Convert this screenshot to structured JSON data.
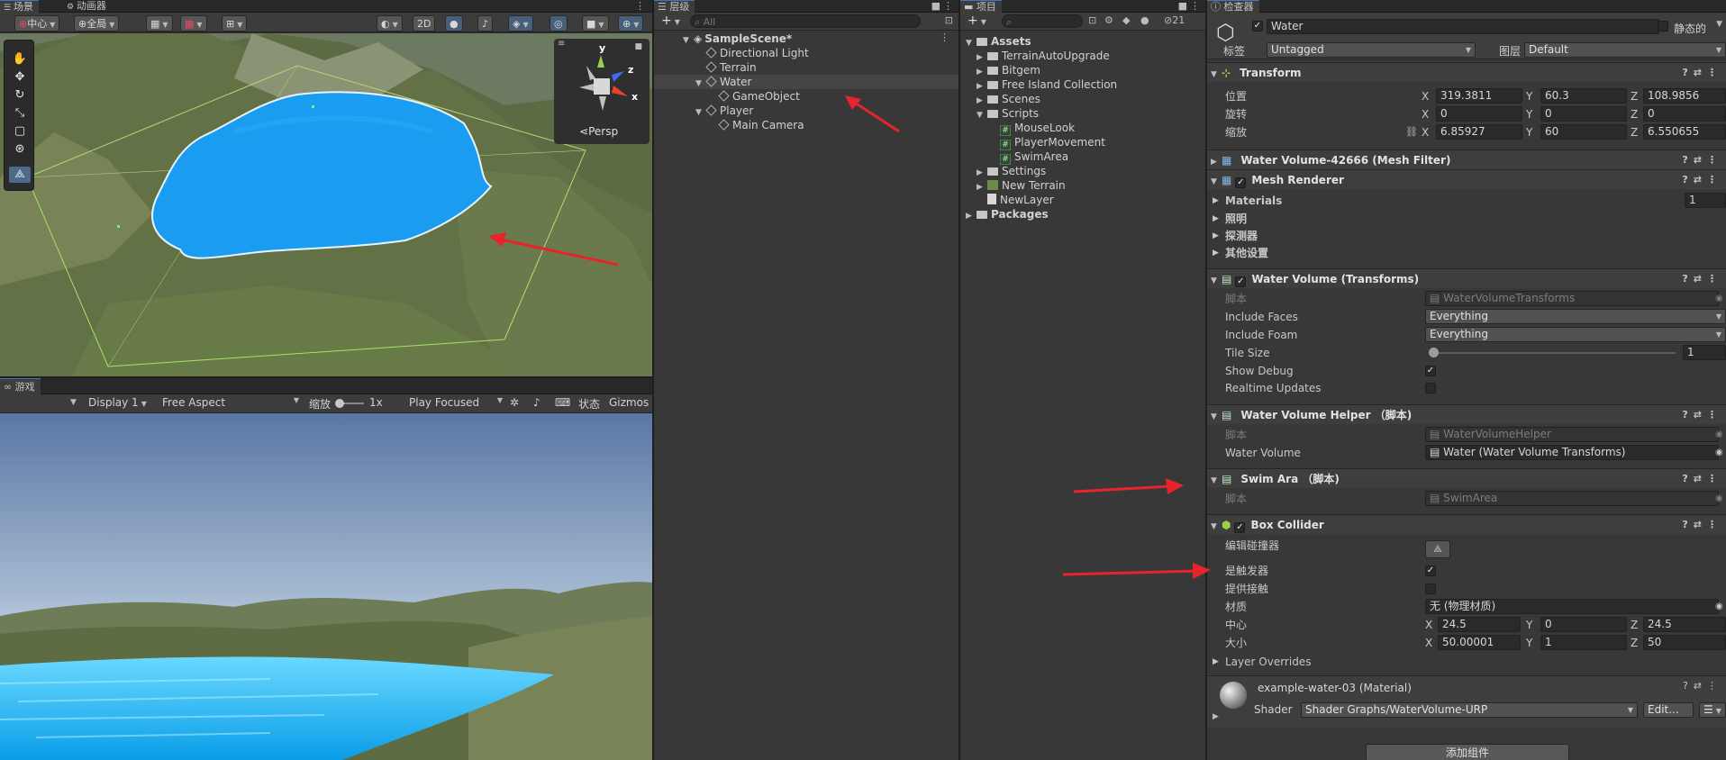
{
  "scene": {
    "tabs": [
      "场景",
      "动画器"
    ],
    "toolbar": {
      "pivot": "中心",
      "global": "全局",
      "mode2d": "2D"
    },
    "gizmo": {
      "y": "y",
      "z": "z",
      "x": "x",
      "persp": "Persp"
    }
  },
  "game": {
    "tab": "游戏",
    "toolbar": {
      "display": "Display 1",
      "aspect": "Free Aspect",
      "scale_label": "缩放",
      "scale_value": "1x",
      "play_mode": "Play Focused",
      "stats": "状态",
      "gizmos": "Gizmos"
    }
  },
  "hierarchy": {
    "tab": "层级",
    "search_placeholder": "All",
    "items": [
      {
        "label": "SampleScene*"
      },
      {
        "label": "Directional Light"
      },
      {
        "label": "Terrain"
      },
      {
        "label": "Water"
      },
      {
        "label": "GameObject"
      },
      {
        "label": "Player"
      },
      {
        "label": "Main Camera"
      }
    ]
  },
  "project": {
    "tab": "项目",
    "hidden_count": "21",
    "items": [
      {
        "label": "Assets"
      },
      {
        "label": "TerrainAutoUpgrade"
      },
      {
        "label": "Bitgem"
      },
      {
        "label": "Free Island Collection"
      },
      {
        "label": "Scenes"
      },
      {
        "label": "Scripts"
      },
      {
        "label": "MouseLook"
      },
      {
        "label": "PlayerMovement"
      },
      {
        "label": "SwimArea"
      },
      {
        "label": "Settings"
      },
      {
        "label": "New Terrain"
      },
      {
        "label": "NewLayer"
      },
      {
        "label": "Packages"
      }
    ]
  },
  "inspector": {
    "tab": "检查器",
    "object_name": "Water",
    "static_label": "静态的",
    "tag_label": "标签",
    "tag_value": "Untagged",
    "layer_label": "图层",
    "layer_value": "Default",
    "transform": {
      "title": "Transform",
      "position_label": "位置",
      "rotation_label": "旋转",
      "scale_label": "缩放",
      "position": {
        "x": "319.3811",
        "y": "60.3",
        "z": "108.9856"
      },
      "rotation": {
        "x": "0",
        "y": "0",
        "z": "0"
      },
      "scale": {
        "x": "6.85927",
        "y": "60",
        "z": "6.550655"
      }
    },
    "mesh_filter": {
      "title": "Water Volume-42666 (Mesh Filter)"
    },
    "mesh_renderer": {
      "title": "Mesh Renderer",
      "materials_label": "Materials",
      "materials_count": "1",
      "lighting": "照明",
      "probes": "探测器",
      "other": "其他设置"
    },
    "water_volume": {
      "title": "Water  Volume (Transforms)",
      "script_label": "脚本",
      "script_value": "WaterVolumeTransforms",
      "include_faces_label": "Include Faces",
      "include_faces_value": "Everything",
      "include_foam_label": "Include Foam",
      "include_foam_value": "Everything",
      "tile_size_label": "Tile Size",
      "tile_size_value": "1",
      "show_debug_label": "Show Debug",
      "realtime_label": "Realtime Updates"
    },
    "helper": {
      "title": "Water Volume Helper （脚本)",
      "script_label": "脚本",
      "script_value": "WaterVolumeHelper",
      "water_volume_label": "Water Volume",
      "water_volume_value": "Water (Water Volume Transforms)"
    },
    "swim": {
      "title": "Swim Ara （脚本)",
      "script_label": "脚本",
      "script_value": "SwimArea"
    },
    "box_collider": {
      "title": "Box Collider",
      "edit_label": "编辑碰撞器",
      "trigger_label": "是触发器",
      "contacts_label": "提供接触",
      "material_label": "材质",
      "material_value": "无 (物理材质)",
      "center_label": "中心",
      "center": {
        "x": "24.5",
        "y": "0",
        "z": "24.5"
      },
      "size_label": "大小",
      "size": {
        "x": "50.00001",
        "y": "1",
        "z": "50"
      },
      "layer_overrides": "Layer Overrides"
    },
    "material": {
      "title": "example-water-03 (Material)",
      "shader_label": "Shader",
      "shader_value": "Shader Graphs/WaterVolume-URP",
      "edit_button": "Edit..."
    },
    "add_component": "添加组件"
  },
  "colors": {
    "accent": "#3a79bb",
    "water": "#1a9cf0",
    "arrow": "#e8232b",
    "panel": "#383838"
  }
}
